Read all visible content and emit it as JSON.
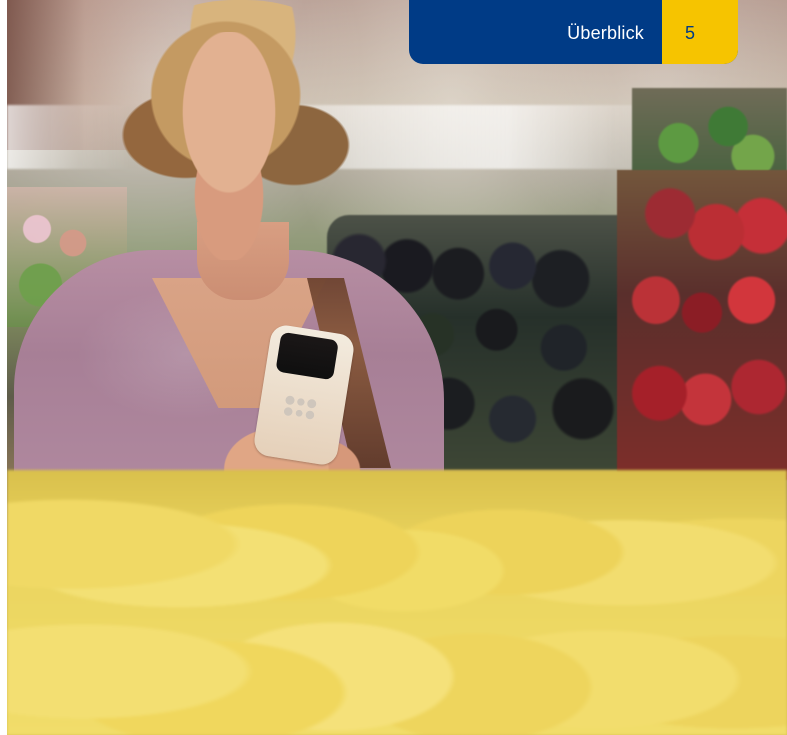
{
  "header": {
    "title": "Überblick",
    "page_number": "5",
    "colors": {
      "blue": "#003b86",
      "yellow": "#f6c400",
      "text_white": "#ffffff"
    }
  },
  "photo": {
    "description_visible": "",
    "subject": ""
  }
}
